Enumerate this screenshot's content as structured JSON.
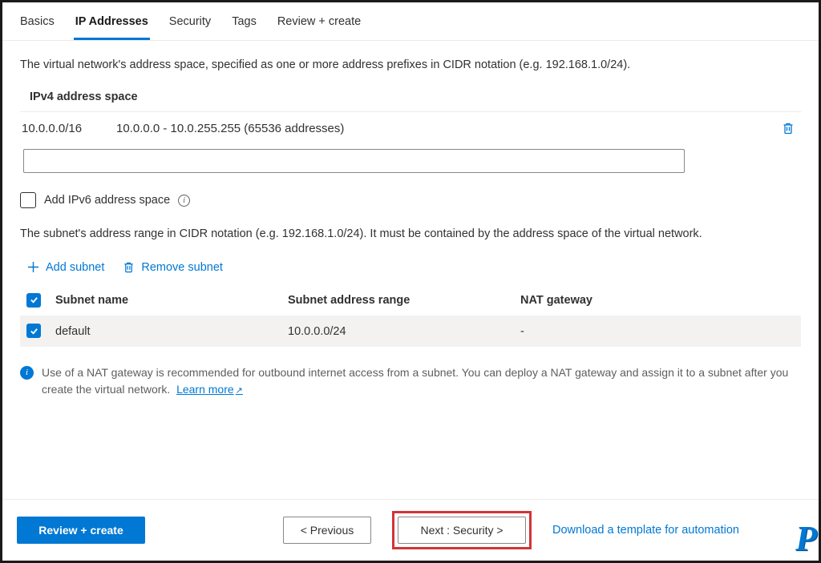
{
  "tabs": {
    "basics": "Basics",
    "ip": "IP Addresses",
    "security": "Security",
    "tags": "Tags",
    "review": "Review + create"
  },
  "descriptions": {
    "addr_space": "The virtual network's address space, specified as one or more address prefixes in CIDR notation (e.g. 192.168.1.0/24).",
    "subnet": "The subnet's address range in CIDR notation (e.g. 192.168.1.0/24). It must be contained by the address space of the virtual network.",
    "nat_note": "Use of a NAT gateway is recommended for outbound internet access from a subnet. You can deploy a NAT gateway and assign it to a subnet after you create the virtual network.",
    "learn_more": "Learn more"
  },
  "labels": {
    "ipv4_section": "IPv4 address space",
    "ipv6_checkbox": "Add IPv6 address space",
    "add_subnet": "Add subnet",
    "remove_subnet": "Remove subnet"
  },
  "address_entry": {
    "cidr": "10.0.0.0/16",
    "range": "10.0.0.0 - 10.0.255.255 (65536 addresses)"
  },
  "subnet_table": {
    "headers": {
      "name": "Subnet name",
      "range": "Subnet address range",
      "nat": "NAT gateway"
    },
    "rows": [
      {
        "name": "default",
        "range": "10.0.0.0/24",
        "nat": "-"
      }
    ]
  },
  "footer": {
    "review": "Review + create",
    "previous": "< Previous",
    "next": "Next : Security >",
    "template_link": "Download a template for automation"
  },
  "logo": "P"
}
